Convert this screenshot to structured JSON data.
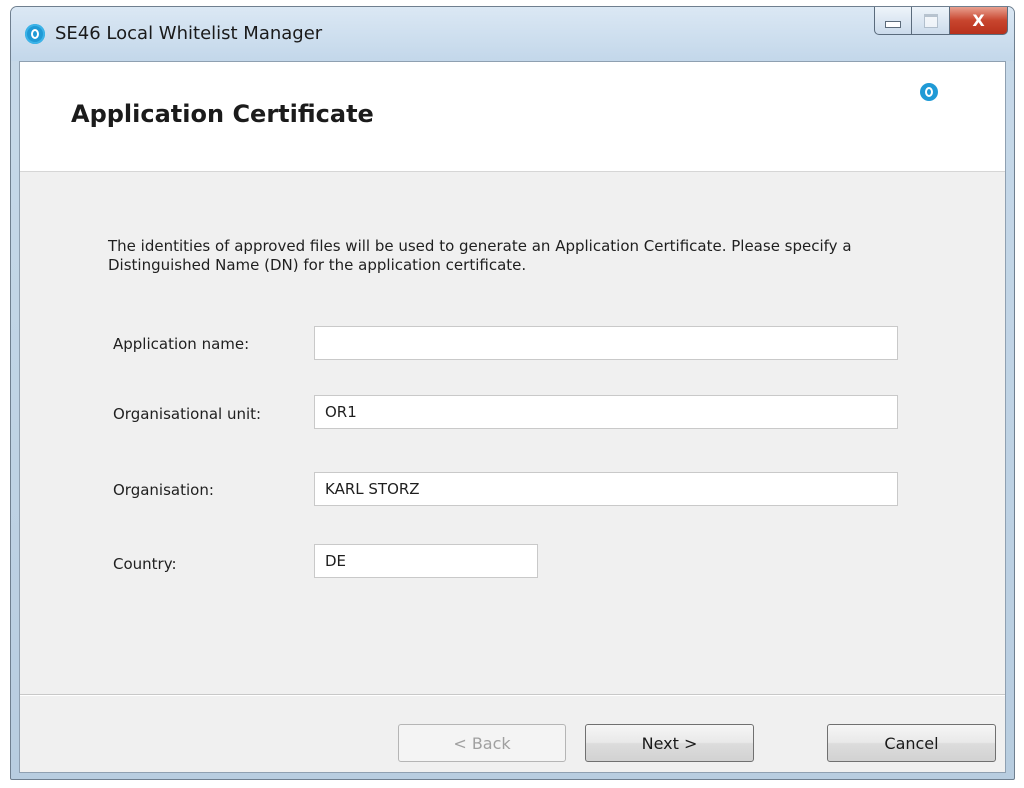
{
  "window": {
    "title": "SE46 Local Whitelist Manager",
    "close_glyph": "X",
    "icons": [
      "app-logo-icon",
      "minimize-icon",
      "maximize-icon",
      "close-icon"
    ]
  },
  "header": {
    "title": "Application Certificate",
    "logo_icon": "app-logo-icon"
  },
  "description": "The identities of approved files will be used to generate an Application Certificate. Please specify a Distinguished Name (DN) for the application certificate.",
  "form": {
    "application_name": {
      "label": "Application name:",
      "value": ""
    },
    "organisational_unit": {
      "label": "Organisational unit:",
      "value": "OR1"
    },
    "organisation": {
      "label": "Organisation:",
      "value": "KARL STORZ"
    },
    "country": {
      "label": "Country:",
      "value": "DE"
    }
  },
  "buttons": {
    "back": {
      "label": "< Back",
      "enabled": false
    },
    "next": {
      "label": "Next >",
      "enabled": true
    },
    "cancel": {
      "label": "Cancel",
      "enabled": true
    }
  },
  "colors": {
    "accent": "#1f9ad6",
    "close_button": "#c8452e",
    "dialog_background": "#f0f0f0"
  }
}
